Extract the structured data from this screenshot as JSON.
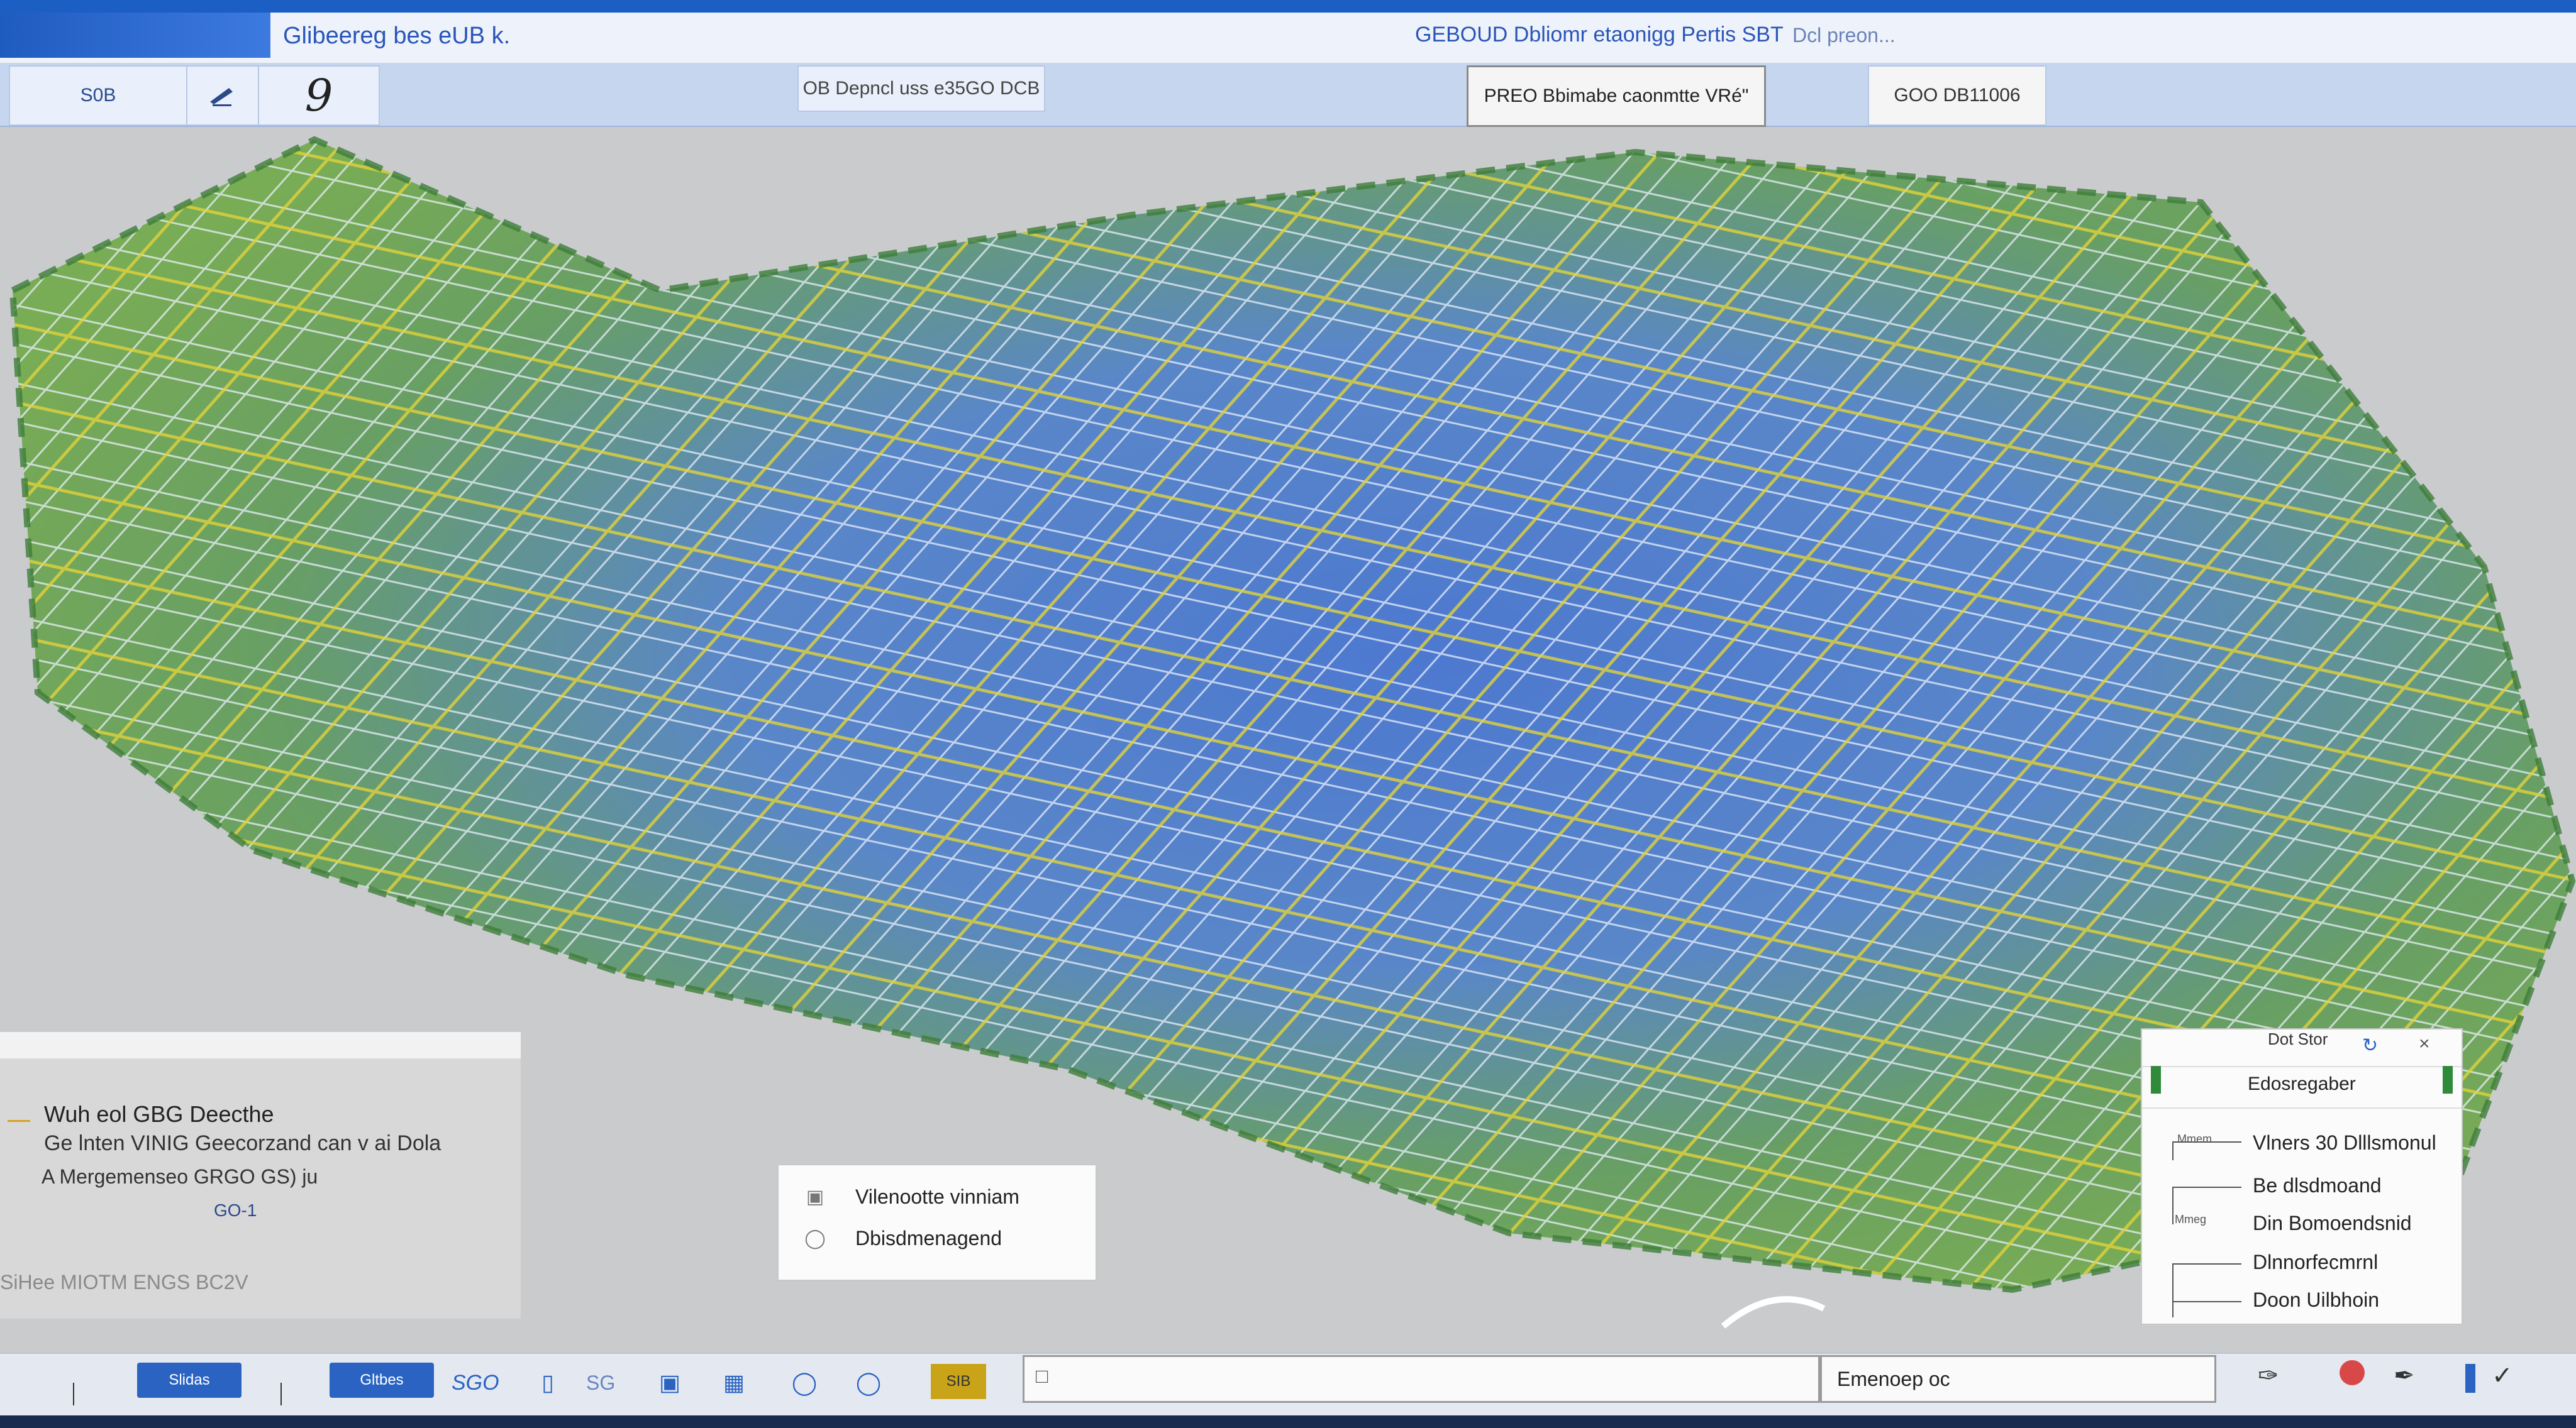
{
  "titlebar": {
    "app_title": "Glibeereg bes eUB k.",
    "doc_title": "GEBOUD Dbliomr etaonigg Pertis SBT",
    "doc_sub": "Dcl preon..."
  },
  "toolbar": {
    "field_value": "S0B",
    "dep_label": "OB Depncl uss  e35GO DCB",
    "select_value": "PREO Bbimabe caonmtte  VRé\"",
    "value_box": "GOO DB11006"
  },
  "info_panel": {
    "title": "Wuh eol GBG Deecthe",
    "line1": "Ge lnten VINIG Geecorzand can v ai Dola",
    "line2": "A Mergemenseo GRGO GS) ju",
    "badge": "GO-1",
    "footer": "SiHee MIOTM ENGS BC2V"
  },
  "legend": {
    "items": [
      {
        "label": "Vilenootte vinniam",
        "icon": "grid-icon"
      },
      {
        "label": "Dbisdmenagend",
        "icon": "circle-icon"
      }
    ]
  },
  "props_panel": {
    "header": "Dot Stor",
    "title": "Edosregaber",
    "items": [
      "Vlners 30 Dlllsmonul",
      "Be dlsdmoand",
      "Din Bomoendsnid",
      "Dlnnorfecmrnl",
      "Doon Uilbhoin"
    ],
    "tree_labels": [
      "Mmem",
      "Mmeg"
    ]
  },
  "statusbar": {
    "btn1": "Slidas",
    "btn2": "Gltbes",
    "label1": "SGO",
    "label2": "SG",
    "highlight": "SIB",
    "cmd_value": "Emenoep oc"
  },
  "colors": {
    "accent": "#2a63c2",
    "mesh_green": "#4f9a4a",
    "mesh_blue": "#3a6bc2",
    "mesh_yellow": "#d8d040"
  }
}
